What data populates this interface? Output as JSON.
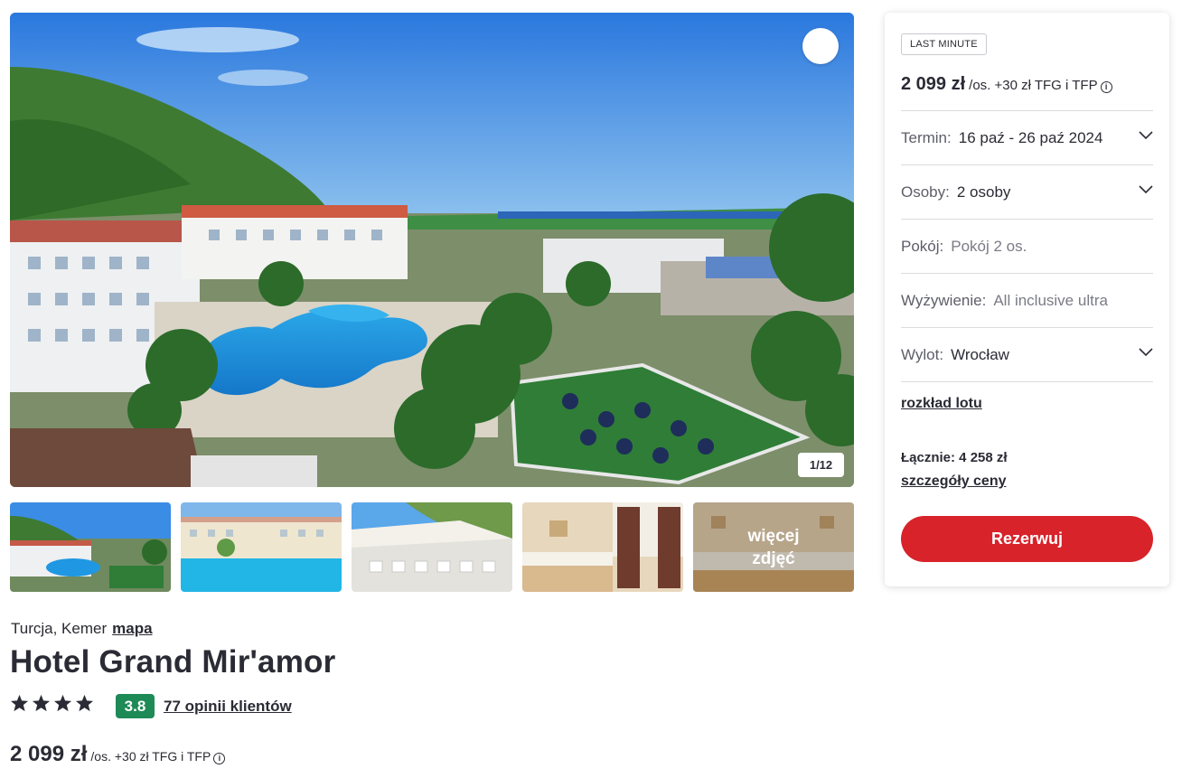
{
  "gallery": {
    "counter": "1/12",
    "more_photos_label": "więcej\nzdjęć",
    "favorite_icon": "heart-icon"
  },
  "hotel": {
    "location": "Turcja, Kemer",
    "map_link": "mapa",
    "name": "Hotel Grand Mir'amor",
    "stars": 4,
    "rating": "3.8",
    "rating_color": "#1e8a56",
    "reviews_link": "77 opinii klientów",
    "price": "2 099 zł",
    "price_suffix": "/os. +30 zł TFG i TFP"
  },
  "booking": {
    "tag": "LAST MINUTE",
    "price": "2 099 zł",
    "price_suffix": "/os. +30 zł TFG i TFP",
    "rows": [
      {
        "label": "Termin:",
        "value": "16 paź - 26 paź 2024"
      },
      {
        "label": "Osoby:",
        "value": "2 osoby"
      },
      {
        "label": "Pokój:",
        "value": "Pokój 2 os."
      },
      {
        "label": "Wyżywienie:",
        "value": "All inclusive ultra"
      },
      {
        "label": "Wylot:",
        "value": "Wrocław"
      }
    ],
    "flight_schedule_link": "rozkład lotu",
    "total": "Łącznie: 4 258 zł",
    "price_details_link": "szczegóły ceny",
    "reserve_button": "Rezerwuj",
    "accent_color": "#d8232a"
  }
}
